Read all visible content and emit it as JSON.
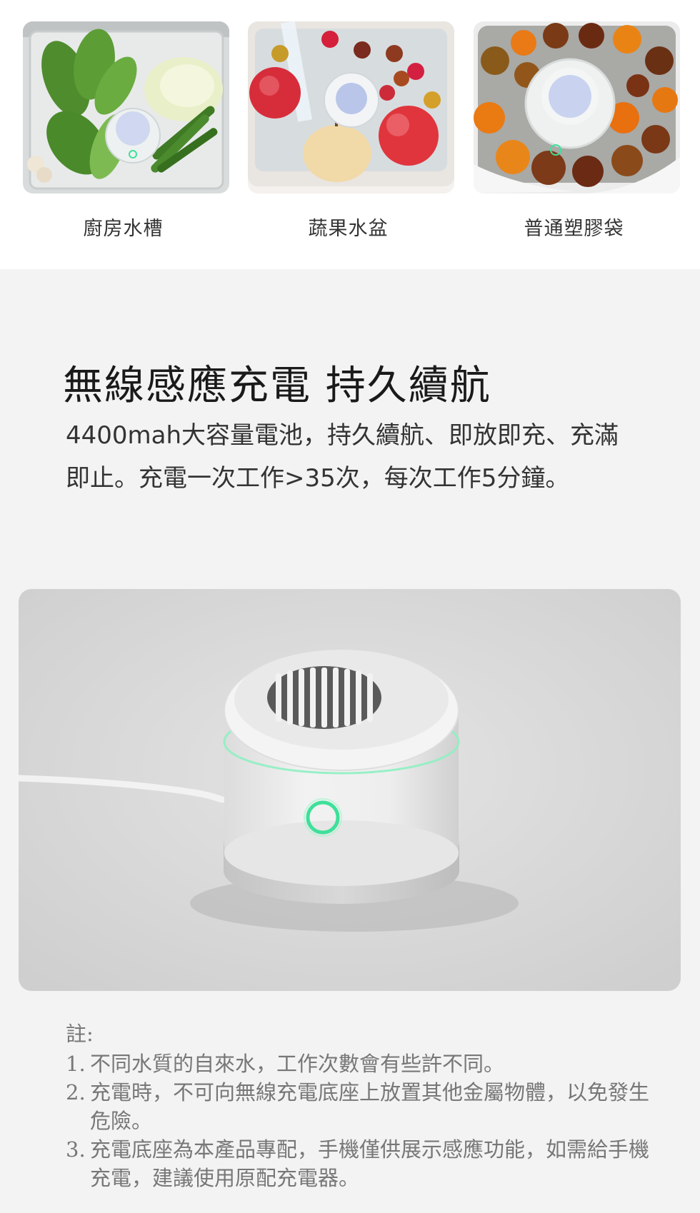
{
  "scenes": [
    {
      "label": "廚房水槽",
      "image": "vegetables-in-kitchen-sink-with-device"
    },
    {
      "label": "蔬果水盆",
      "image": "fruits-in-water-basin-with-device"
    },
    {
      "label": "普通塑膠袋",
      "image": "jujubes-and-oranges-in-plastic-bag-with-device"
    }
  ],
  "feature": {
    "title": "無線感應充電 持久續航",
    "description": "4400mah大容量電池，持久續航、即放即充、充滿即止。充電一次工作>35次，每次工作5分鐘。"
  },
  "product_photo": {
    "image": "white-purifier-on-wireless-charging-base",
    "indicator_color": "#3fe09a"
  },
  "notes": {
    "heading": "註:",
    "items": [
      {
        "number": "1.",
        "text": "不同水質的自來水，工作次數會有些許不同。"
      },
      {
        "number": "2.",
        "text": "充電時，不可向無線充電底座上放置其他金屬物體，以免發生危險。"
      },
      {
        "number": "3.",
        "text": "充電底座為本產品專配，手機僅供展示感應功能，如需給手機充電，建議使用原配充電器。"
      }
    ]
  }
}
